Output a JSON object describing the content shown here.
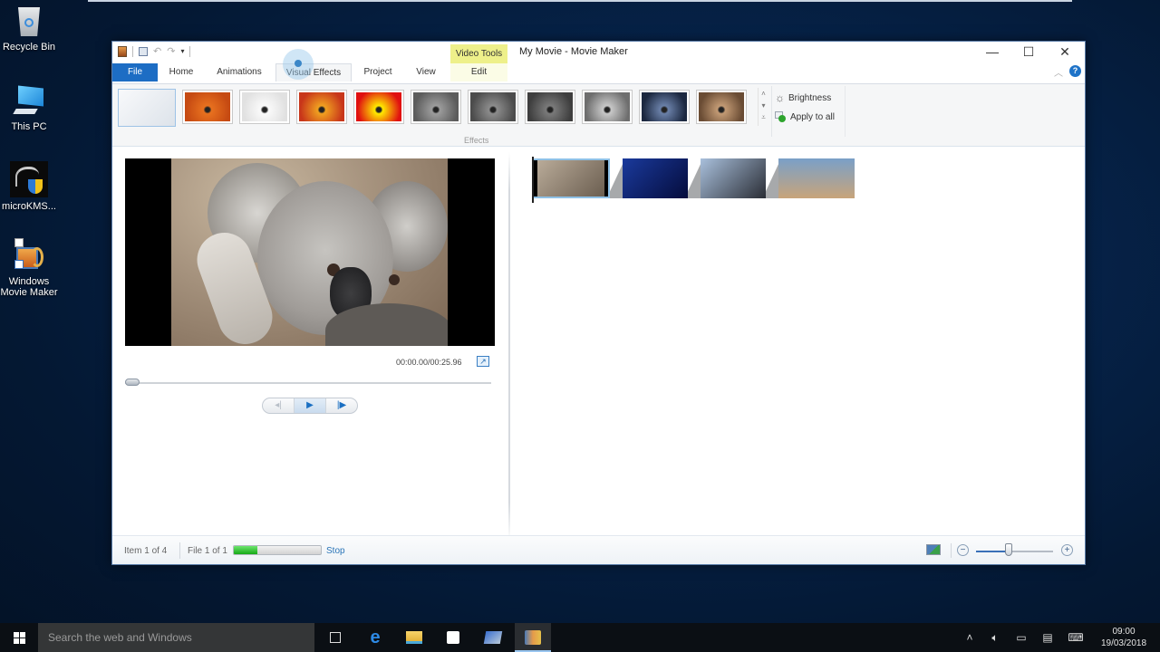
{
  "desktop": {
    "icons": [
      {
        "label": "Recycle Bin"
      },
      {
        "label": "This PC"
      },
      {
        "label": "microKMS..."
      },
      {
        "label": "Windows Movie Maker"
      }
    ]
  },
  "window": {
    "title": "My Movie - Movie Maker",
    "contextual_group": "Video Tools",
    "controls": {
      "minimize": "—",
      "maximize": "☐",
      "close": "✕"
    },
    "help": "?"
  },
  "ribbon": {
    "tabs": [
      {
        "label": "File"
      },
      {
        "label": "Home"
      },
      {
        "label": "Animations"
      },
      {
        "label": "Visual Effects"
      },
      {
        "label": "Project"
      },
      {
        "label": "View"
      },
      {
        "label": "Edit"
      }
    ],
    "active_tab": "Visual Effects",
    "effects_group_label": "Effects",
    "effects": [
      {
        "name": "No effect",
        "colors": [
          "#f6f7f9",
          "#dbe1e8"
        ]
      },
      {
        "name": "Orange warm",
        "colors": [
          "#e8711f",
          "#c64a12"
        ]
      },
      {
        "name": "Edge detect",
        "colors": [
          "#fafafa",
          "#e1e1e1"
        ]
      },
      {
        "name": "Posterize",
        "colors": [
          "#f0a020",
          "#c8361a"
        ]
      },
      {
        "name": "Threshold",
        "colors": [
          "#ffea00",
          "#e01010"
        ]
      },
      {
        "name": "Grayscale",
        "colors": [
          "#9c9c9c",
          "#5c5c5c"
        ]
      },
      {
        "name": "Black and white",
        "colors": [
          "#8c8c8c",
          "#4c4c4c"
        ]
      },
      {
        "name": "Black and white dark",
        "colors": [
          "#7a7a7a",
          "#3e3e3e"
        ]
      },
      {
        "name": "Black and white light",
        "colors": [
          "#c8c8c8",
          "#6e6e6e"
        ]
      },
      {
        "name": "Cyanotype",
        "colors": [
          "#6a80a8",
          "#1c2840"
        ]
      },
      {
        "name": "Sepia",
        "colors": [
          "#c29a74",
          "#6a4c34"
        ]
      }
    ],
    "brightness_label": "Brightness",
    "apply_all_label": "Apply to all"
  },
  "preview": {
    "timecode": "00:00.00/00:25.96",
    "seek_position_fraction": 0.0
  },
  "storyboard": {
    "clips": [
      {
        "name": "Koala",
        "colors": [
          "#b9ab99",
          "#6b5e50"
        ]
      },
      {
        "name": "Jellyfish",
        "colors": [
          "#1a3a9c",
          "#050c3c"
        ]
      },
      {
        "name": "Penguins",
        "colors": [
          "#a9c0dc",
          "#2a2d35"
        ]
      },
      {
        "name": "Desert",
        "colors": [
          "#7aa0c8",
          "#c8a47a"
        ]
      }
    ],
    "selected_clip": 0
  },
  "status": {
    "item": "Item 1 of 4",
    "file": "File 1 of 1",
    "progress_fraction": 0.27,
    "stop_label": "Stop",
    "zoom_fraction": 0.42
  },
  "taskbar": {
    "search_placeholder": "Search the web and Windows",
    "time": "09:00",
    "date": "19/03/2018"
  }
}
